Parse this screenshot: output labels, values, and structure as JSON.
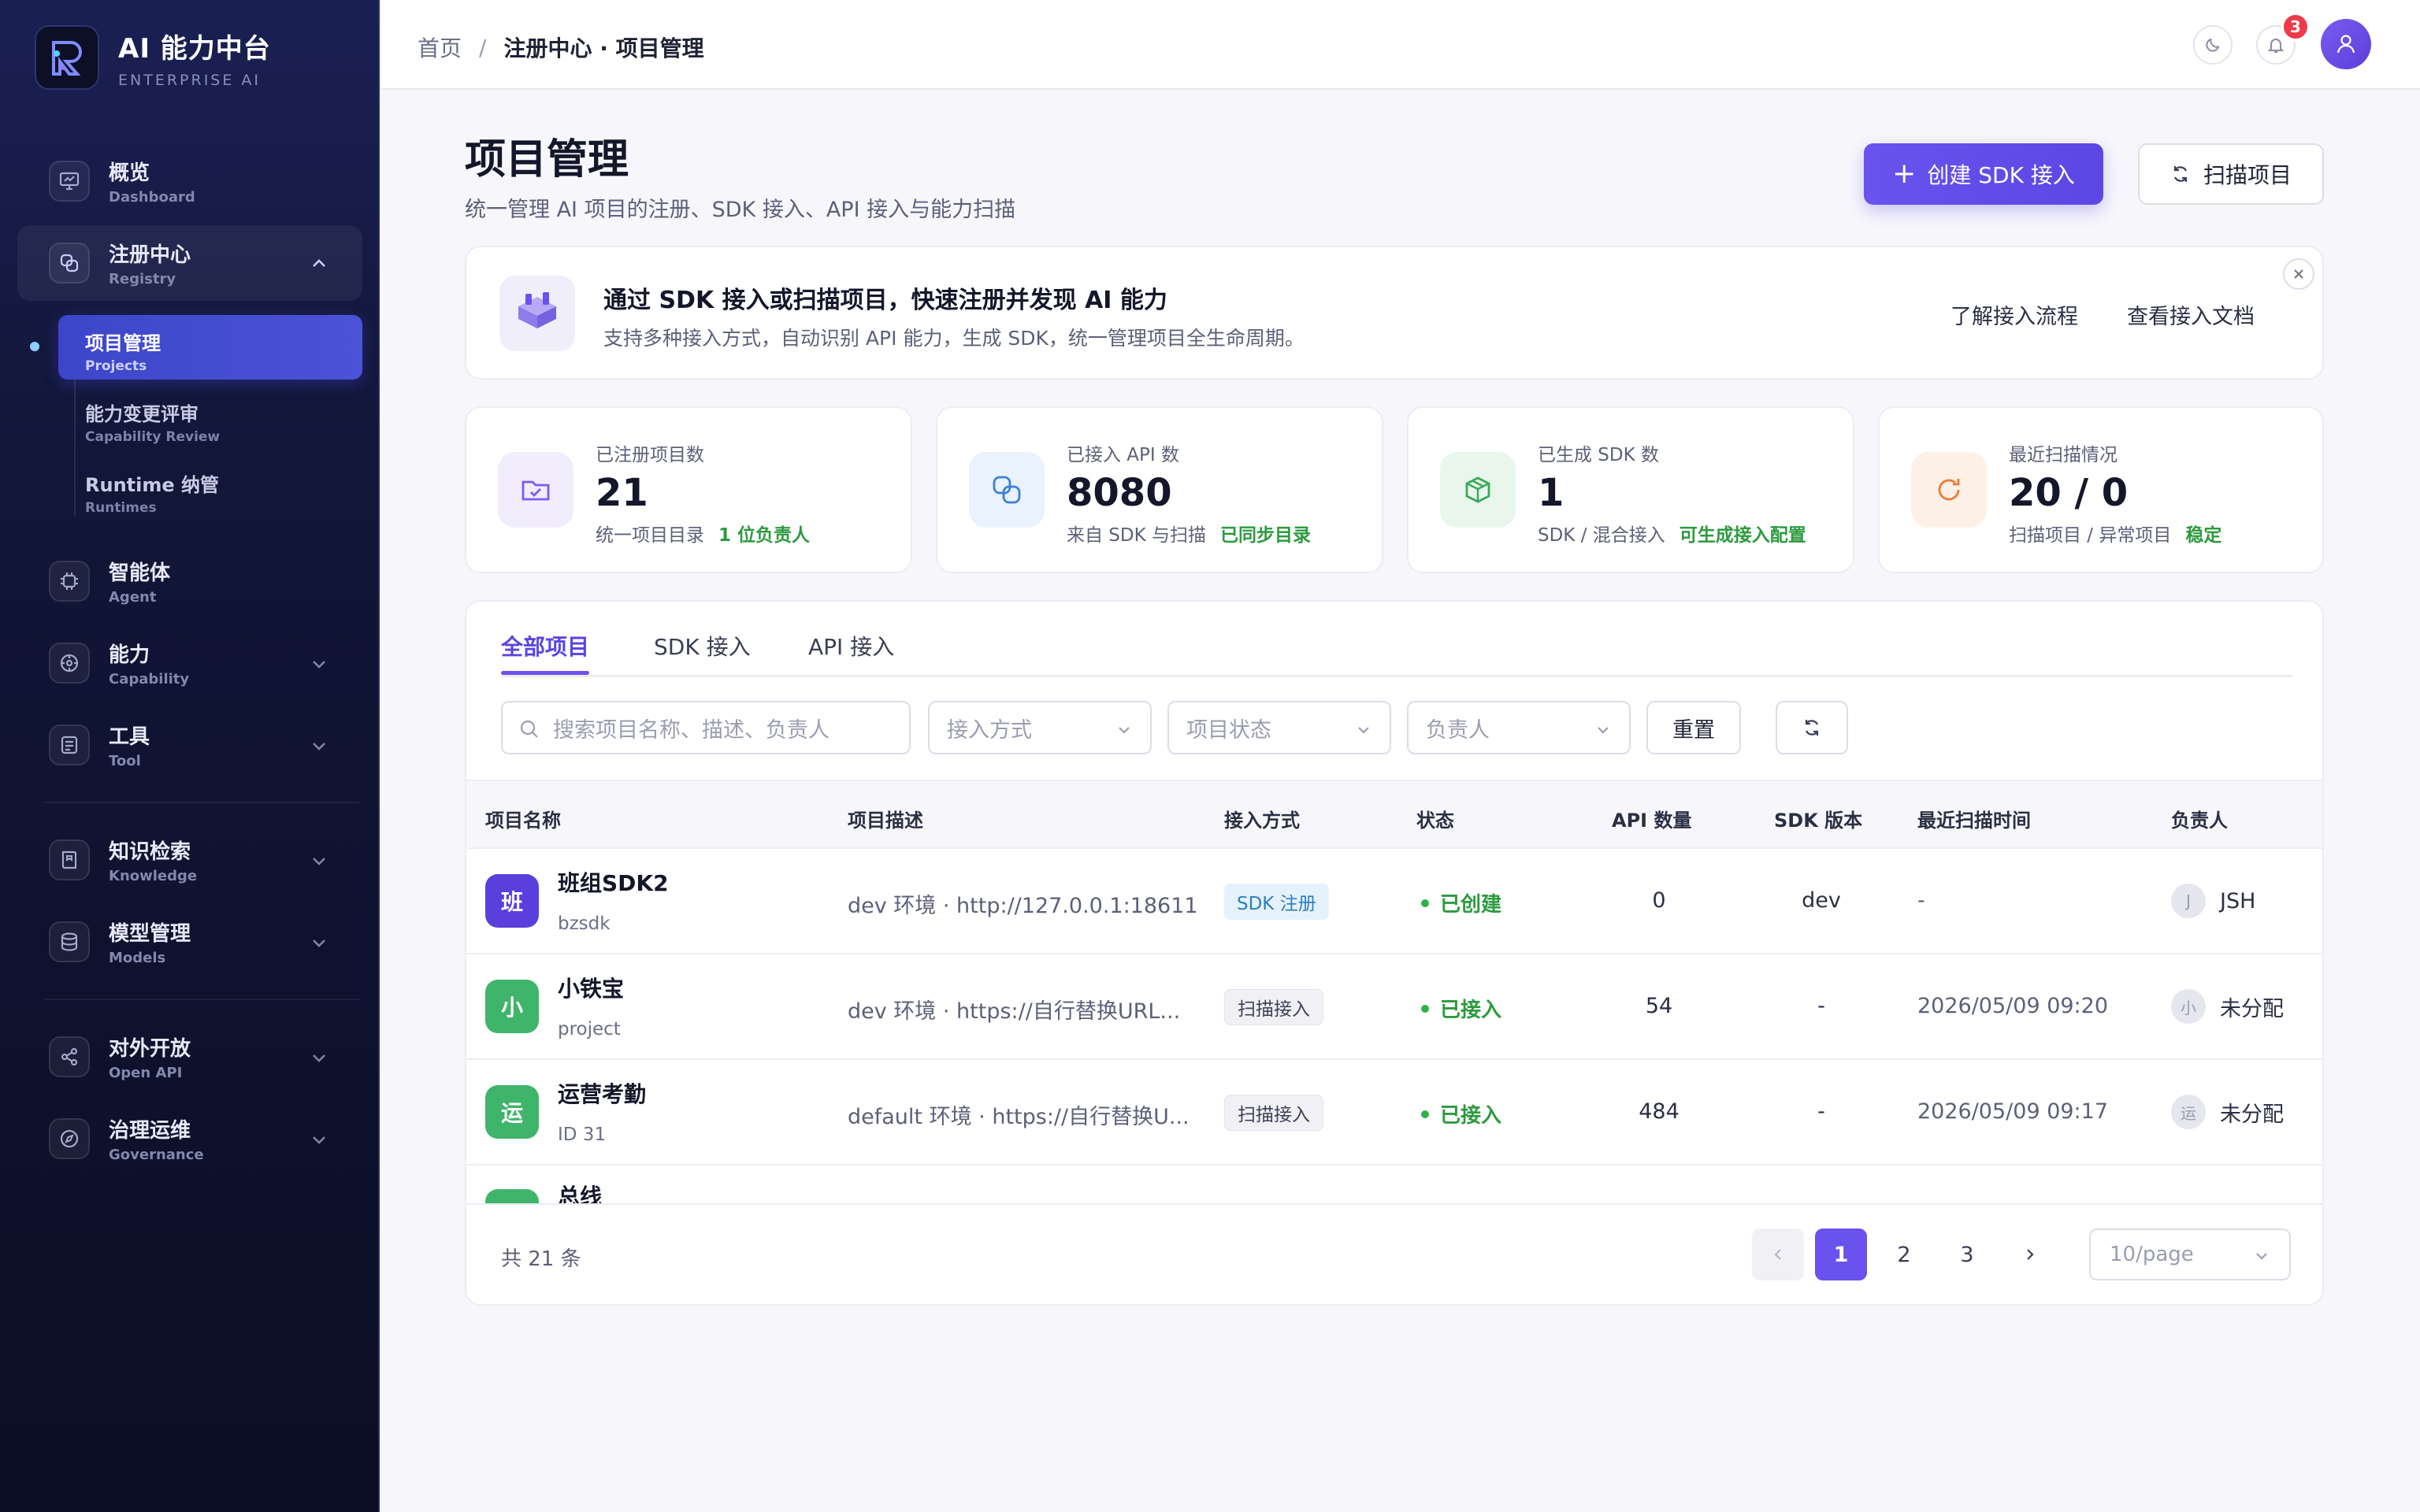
{
  "brand": {
    "title": "AI 能力中台",
    "subtitle": "ENTERPRISE AI"
  },
  "nav": {
    "overview": {
      "label": "概览",
      "sub": "Dashboard"
    },
    "registry": {
      "label": "注册中心",
      "sub": "Registry"
    },
    "registry_children": [
      {
        "label": "项目管理",
        "sub": "Projects"
      },
      {
        "label": "能力变更评审",
        "sub": "Capability Review"
      },
      {
        "label": "Runtime 纳管",
        "sub": "Runtimes"
      }
    ],
    "agent": {
      "label": "智能体",
      "sub": "Agent"
    },
    "capability": {
      "label": "能力",
      "sub": "Capability"
    },
    "tool": {
      "label": "工具",
      "sub": "Tool"
    },
    "knowledge": {
      "label": "知识检索",
      "sub": "Knowledge"
    },
    "models": {
      "label": "模型管理",
      "sub": "Models"
    },
    "openapi": {
      "label": "对外开放",
      "sub": "Open API"
    },
    "governance": {
      "label": "治理运维",
      "sub": "Governance"
    }
  },
  "header": {
    "breadcrumb_home": "首页",
    "breadcrumb_sep": "/",
    "breadcrumb_current": "注册中心 · 项目管理",
    "notification_count": "3"
  },
  "page": {
    "title": "项目管理",
    "description": "统一管理 AI 项目的注册、SDK 接入、API 接入与能力扫描",
    "create_button": "创建 SDK 接入",
    "scan_button": "扫描项目"
  },
  "banner": {
    "title": "通过 SDK 接入或扫描项目，快速注册并发现 AI 能力",
    "description": "支持多种接入方式，自动识别 API 能力，生成 SDK，统一管理项目全生命周期。",
    "link_flow": "了解接入流程",
    "link_docs": "查看接入文档"
  },
  "stats": [
    {
      "label": "已注册项目数",
      "value": "21",
      "foot": "统一项目目录",
      "highlight": "1 位负责人"
    },
    {
      "label": "已接入 API 数",
      "value": "8080",
      "foot": "来自 SDK 与扫描",
      "highlight": "已同步目录"
    },
    {
      "label": "已生成 SDK 数",
      "value": "1",
      "foot": "SDK / 混合接入",
      "highlight": "可生成接入配置"
    },
    {
      "label": "最近扫描情况",
      "value": "20 / 0",
      "foot": "扫描项目 / 异常项目",
      "highlight": "稳定"
    }
  ],
  "tabs": [
    "全部项目",
    "SDK 接入",
    "API 接入"
  ],
  "filters": {
    "search_placeholder": "搜索项目名称、描述、负责人",
    "access_method": "接入方式",
    "status": "项目状态",
    "owner": "负责人",
    "reset": "重置"
  },
  "table": {
    "columns": [
      "项目名称",
      "项目描述",
      "接入方式",
      "状态",
      "API 数量",
      "SDK 版本",
      "最近扫描时间",
      "负责人"
    ],
    "rows": [
      {
        "avatar": "班",
        "avatar_color": "#5b3fdc",
        "name": "班组SDK2",
        "sub": "bzsdk",
        "desc": "dev 环境 · http://127.0.0.1:18611",
        "method": "SDK 注册",
        "method_type": "sdk",
        "status": "已创建",
        "api": "0",
        "sdk": "dev",
        "time": "-",
        "owner_initial": "J",
        "owner": "JSH"
      },
      {
        "avatar": "小",
        "avatar_color": "#3fb56b",
        "name": "小铁宝",
        "sub": "project",
        "desc": "dev 环境 · https://自行替换URL...",
        "method": "扫描接入",
        "method_type": "scan",
        "status": "已接入",
        "api": "54",
        "sdk": "-",
        "time": "2026/05/09 09:20",
        "owner_initial": "小",
        "owner": "未分配"
      },
      {
        "avatar": "运",
        "avatar_color": "#3fb56b",
        "name": "运营考勤",
        "sub": "ID 31",
        "desc": "default 环境 · https://自行替换U...",
        "method": "扫描接入",
        "method_type": "scan",
        "status": "已接入",
        "api": "484",
        "sdk": "-",
        "time": "2026/05/09 09:17",
        "owner_initial": "运",
        "owner": "未分配"
      },
      {
        "avatar": "总",
        "avatar_color": "#3fb56b",
        "name": "总线"
      }
    ]
  },
  "pagination": {
    "total": "共 21 条",
    "pages": [
      "1",
      "2",
      "3"
    ],
    "page_size": "10/page"
  },
  "colors": {
    "accent": "#6a52ee",
    "success": "#2c9b3e",
    "sidebar": "#121638"
  }
}
